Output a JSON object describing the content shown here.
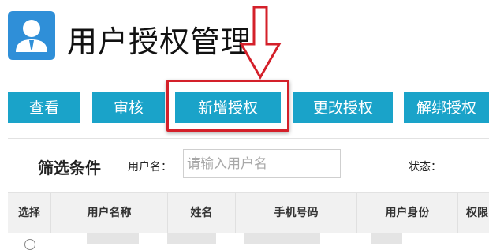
{
  "header": {
    "title": "用户授权管理",
    "icon": "user-manager-icon"
  },
  "toolbar": {
    "buttons": [
      {
        "label": "查看"
      },
      {
        "label": "审核"
      },
      {
        "label": "新增授权"
      },
      {
        "label": "更改授权"
      },
      {
        "label": "解绑授权"
      }
    ]
  },
  "filter": {
    "title": "筛选条件",
    "username_label": "用户名：",
    "username_placeholder": "请输入用户名",
    "status_label": "状态："
  },
  "table": {
    "columns": [
      "选择",
      "用户名称",
      "姓名",
      "手机号码",
      "用户身份",
      "权限"
    ]
  },
  "colors": {
    "accent": "#1aa3c9",
    "icon_bg": "#2f8fd8",
    "annotation": "#d4202a"
  }
}
